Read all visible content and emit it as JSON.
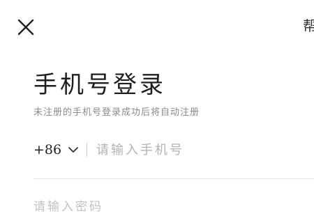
{
  "header": {
    "close_icon": "close-icon",
    "help_label": "帮"
  },
  "login": {
    "title": "手机号登录",
    "subtitle": "未注册的手机号登录成功后将自动注册",
    "country_code": "+86",
    "country_chevron_icon": "chevron-down-icon",
    "phone_placeholder": "请输入手机号",
    "password_placeholder": "请输入密码"
  },
  "colors": {
    "background": "#ffffff",
    "text": "#222222",
    "subtitle": "#8a8a8a",
    "placeholder": "#b3b3b3",
    "divider": "#e6e6e6"
  }
}
